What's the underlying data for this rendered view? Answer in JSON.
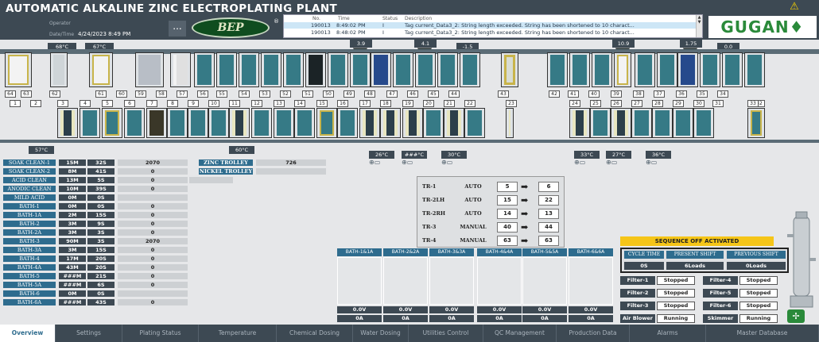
{
  "header": {
    "title": "AUTOMATIC ALKALINE ZINC ELECTROPLATING PLANT",
    "operator_label": "Operator",
    "datetime_label": "Date/Time",
    "datetime_value": "4/24/2023 8:49 PM",
    "menu_button": "...",
    "logo_text": "BEP",
    "reg_mark": "®",
    "brand": "GUGAN"
  },
  "alarm": {
    "headers": {
      "no": "No.",
      "time": "Time",
      "status": "Status",
      "desc": "Description"
    },
    "rows": [
      {
        "no": "190013",
        "time": "8:49:02 PM",
        "status": "I",
        "desc": "Tag current_Data3_2: String length exceeded. String has been shortened to 10 charact..."
      },
      {
        "no": "190013",
        "time": "8:48:02 PM",
        "status": "I",
        "desc": "Tag current_Data3_2: String length exceeded. String has been shortened to 10 charact..."
      }
    ]
  },
  "plant": {
    "temps_top": [
      "68°C",
      "67°C"
    ],
    "readings_top": [
      "3.9",
      "4.1",
      "-1.5",
      "10.9",
      "1.75",
      "0.0"
    ],
    "upper_numbers": [
      "64",
      "63",
      "62",
      "61",
      "60",
      "59",
      "58",
      "57",
      "56",
      "55",
      "54",
      "53",
      "52",
      "51",
      "50",
      "49",
      "48",
      "47",
      "46",
      "45",
      "44",
      "43",
      "42",
      "41",
      "40",
      "39",
      "38",
      "37",
      "36",
      "35",
      "34"
    ],
    "lower_numbers": [
      "1",
      "2",
      "3",
      "4",
      "5",
      "6",
      "7",
      "8",
      "9",
      "10",
      "11",
      "12",
      "13",
      "14",
      "15",
      "16",
      "17",
      "18",
      "19",
      "20",
      "21",
      "22",
      "23",
      "24",
      "25",
      "26",
      "27",
      "28",
      "29",
      "30",
      "31",
      "32",
      "33"
    ],
    "temps_bottom": [
      "57°C",
      "60°C",
      "26°C",
      "###°C",
      "30°C",
      "33°C",
      "27°C",
      "36°C"
    ]
  },
  "baths": [
    {
      "name": "SOAK CLEAN-1",
      "time": "15M",
      "sec": "32S",
      "count": "2070"
    },
    {
      "name": "SOAK CLEAN-2",
      "time": "8M",
      "sec": "41S",
      "count": "0"
    },
    {
      "name": "ACID CLEAN",
      "time": "13M",
      "sec": "5S",
      "count": "0"
    },
    {
      "name": "ANODIC CLEAN",
      "time": "10M",
      "sec": "39S",
      "count": "0"
    },
    {
      "name": "MILD ACID",
      "time": "0M",
      "sec": "0S",
      "count": ""
    },
    {
      "name": "BATH-1",
      "time": "0M",
      "sec": "0S",
      "count": "0"
    },
    {
      "name": "BATH-1A",
      "time": "2M",
      "sec": "15S",
      "count": "0"
    },
    {
      "name": "BATH-2",
      "time": "3M",
      "sec": "9S",
      "count": "0"
    },
    {
      "name": "BATH-2A",
      "time": "3M",
      "sec": "3S",
      "count": "0"
    },
    {
      "name": "BATH-3",
      "time": "90M",
      "sec": "3S",
      "count": "2070"
    },
    {
      "name": "BATH-3A",
      "time": "3M",
      "sec": "15S",
      "count": "0"
    },
    {
      "name": "BATH-4",
      "time": "17M",
      "sec": "20S",
      "count": "0"
    },
    {
      "name": "BATH-4A",
      "time": "43M",
      "sec": "20S",
      "count": "0"
    },
    {
      "name": "BATH-5",
      "time": "###M",
      "sec": "21S",
      "count": "0"
    },
    {
      "name": "BATH-5A",
      "time": "###M",
      "sec": "6S",
      "count": "0"
    },
    {
      "name": "BATH-6",
      "time": "0M",
      "sec": "0S",
      "count": ""
    },
    {
      "name": "BATH-6A",
      "time": "###M",
      "sec": "43S",
      "count": "0"
    }
  ],
  "trolleys": [
    {
      "name": "ZINC TROLLEY",
      "value": "726"
    },
    {
      "name": "NICKEL TROLLEY",
      "value": ""
    }
  ],
  "rectifiers": [
    {
      "name": "TR-1",
      "mode": "AUTO",
      "set": "5",
      "actual": "6"
    },
    {
      "name": "TR-2LH",
      "mode": "AUTO",
      "set": "15",
      "actual": "22"
    },
    {
      "name": "TR-2RH",
      "mode": "AUTO",
      "set": "14",
      "actual": "13"
    },
    {
      "name": "TR-3",
      "mode": "MANUAL",
      "set": "40",
      "actual": "44"
    },
    {
      "name": "TR-4",
      "mode": "MANUAL",
      "set": "63",
      "actual": "63"
    }
  ],
  "bath_pairs": [
    {
      "name": "BATH-1&1A",
      "volt": "0.0V",
      "amp": "0A"
    },
    {
      "name": "BATH-2&2A",
      "volt": "0.0V",
      "amp": "0A"
    },
    {
      "name": "BATH-3&3A",
      "volt": "0.0V",
      "amp": "0A"
    },
    {
      "name": "BATH-4&4A",
      "volt": "0.0V",
      "amp": "0A"
    },
    {
      "name": "BATH-5&5A",
      "volt": "0.0V",
      "amp": "0A"
    },
    {
      "name": "BATH-6&6A",
      "volt": "0.0V",
      "amp": "0A"
    }
  ],
  "sequence": {
    "banner": "SEQUENCE OFF ACTIVATED",
    "headers": [
      "CYCLE TIME",
      "PRESENT SHIFT",
      "PREVIOUS SHIFT"
    ],
    "values": [
      "0S",
      "6Loads",
      "0Loads"
    ]
  },
  "filters": [
    {
      "name": "Filter-1",
      "status": "Stopped"
    },
    {
      "name": "Filter-4",
      "status": "Stopped"
    },
    {
      "name": "Filter-2",
      "status": "Stopped"
    },
    {
      "name": "Filter-5",
      "status": "Stopped"
    },
    {
      "name": "Filter-3",
      "status": "Stopped"
    },
    {
      "name": "Filter-6",
      "status": "Stopped"
    },
    {
      "name": "Air Blower",
      "status": "Running"
    },
    {
      "name": "Skimmer",
      "status": "Running"
    }
  ],
  "nav": [
    "Overview",
    "Settings",
    "Plating Status",
    "Temperature",
    "Chemical Dosing",
    "Water Dosing",
    "Utilities Control",
    "QC Management",
    "Production Data",
    "Alarms",
    "Master Database"
  ],
  "colors": {
    "header": "#3d4953",
    "accent": "#2e6c8e",
    "tank_fill": "#367a86",
    "brand_green": "#2a8a3a",
    "warning": "#f5c518"
  },
  "icons": {
    "warning": "warning-triangle-icon",
    "fan": "fan-icon",
    "filter": "filter-tower-icon",
    "sensor": "temperature-sensor-icon"
  }
}
